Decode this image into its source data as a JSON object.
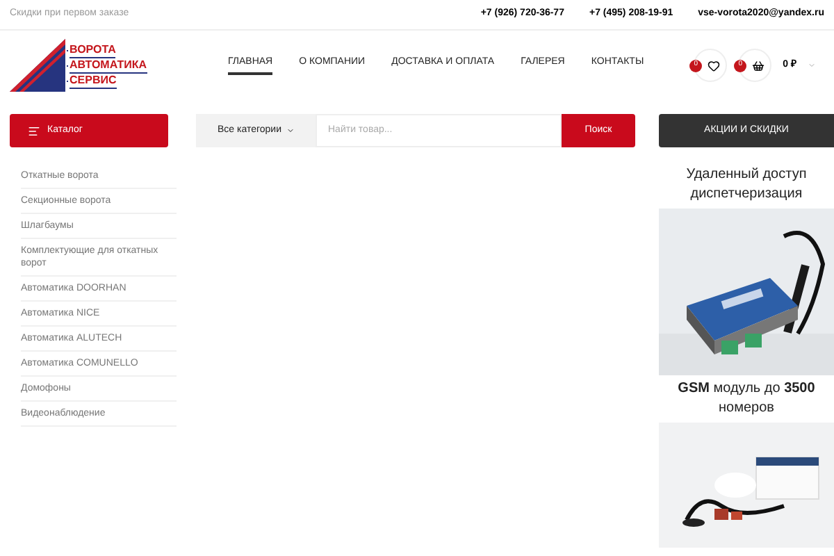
{
  "topbar": {
    "promo": "Скидки при первом заказе",
    "phones": [
      "+7 (926) 720-36-77",
      "+7 (495) 208-19-91"
    ],
    "email": "vse-vorota2020@yandex.ru"
  },
  "logo": {
    "lines": [
      "ВОРОТА",
      "АВТОМАТИКА",
      "СЕРВИС"
    ]
  },
  "nav": [
    {
      "label": "ГЛАВНАЯ",
      "selected": true
    },
    {
      "label": "О КОМПАНИИ",
      "selected": false
    },
    {
      "label": "ДОСТАВКА И ОПЛАТА",
      "selected": false
    },
    {
      "label": "ГАЛЕРЕЯ",
      "selected": false
    },
    {
      "label": "КОНТАКТЫ",
      "selected": false
    }
  ],
  "favorites": {
    "count": "0"
  },
  "cart": {
    "count": "0",
    "total": "0 ₽"
  },
  "catalog_button": "Каталог",
  "search": {
    "category": "Все категории",
    "placeholder": "Найти товар...",
    "button": "Поиск"
  },
  "sale_button": "АКЦИИ И СКИДКИ",
  "categories": [
    "Откатные ворота",
    "Секционные ворота",
    "Шлагбаумы",
    "Комплектующие для откатных ворот",
    "Автоматика DOORHAN",
    "Автоматика NICE",
    "Автоматика ALUTECH",
    "Автоматика COMUNELLO",
    "Домофоны",
    "Видеонаблюдение"
  ],
  "promos": [
    {
      "title": "Удаленный доступ диспетчеризация",
      "kind": "picture"
    },
    {
      "title": "**GSM** модуль до **3500** номеров",
      "kind": "picture"
    }
  ]
}
